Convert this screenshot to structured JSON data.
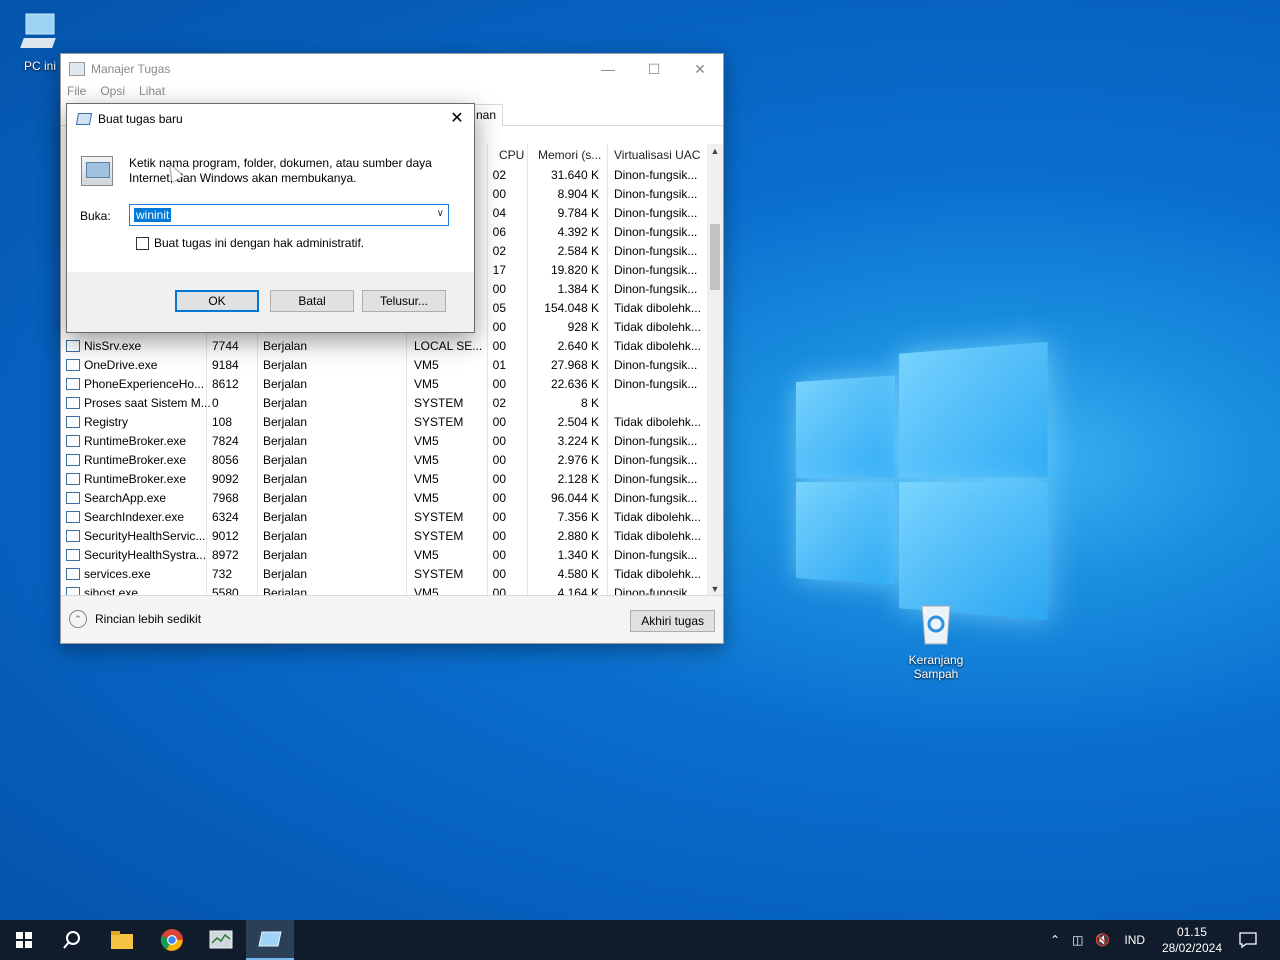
{
  "desktop": {
    "icons": [
      {
        "label": "PC ini"
      },
      {
        "label": "Keranjang Sampah"
      }
    ]
  },
  "taskmgr": {
    "title": "Manajer Tugas",
    "menu": [
      "File",
      "Opsi",
      "Lihat"
    ],
    "tab_partial": "nan",
    "columns": {
      "cpu": "CPU",
      "memory": "Memori (s...",
      "uac": "Virtualisasi UAC"
    },
    "rows": [
      {
        "name": "",
        "pid": "",
        "status": "",
        "user": "",
        "cpu": "02",
        "mem": "31.640 K",
        "uac": "Dinon-fungsik..."
      },
      {
        "name": "",
        "pid": "",
        "status": "",
        "user": "",
        "cpu": "00",
        "mem": "8.904 K",
        "uac": "Dinon-fungsik..."
      },
      {
        "name": "",
        "pid": "",
        "status": "",
        "user": "",
        "cpu": "04",
        "mem": "9.784 K",
        "uac": "Dinon-fungsik..."
      },
      {
        "name": "",
        "pid": "",
        "status": "",
        "user": "",
        "cpu": "06",
        "mem": "4.392 K",
        "uac": "Dinon-fungsik..."
      },
      {
        "name": "",
        "pid": "",
        "status": "",
        "user": "",
        "cpu": "02",
        "mem": "2.584 K",
        "uac": "Dinon-fungsik..."
      },
      {
        "name": "",
        "pid": "",
        "status": "",
        "user": "",
        "cpu": "17",
        "mem": "19.820 K",
        "uac": "Dinon-fungsik..."
      },
      {
        "name": "",
        "pid": "",
        "status": "",
        "user": "",
        "cpu": "00",
        "mem": "1.384 K",
        "uac": "Dinon-fungsik..."
      },
      {
        "name": "",
        "pid": "",
        "status": "",
        "user": "",
        "cpu": "05",
        "mem": "154.048 K",
        "uac": "Tidak dibolehk..."
      },
      {
        "name": "",
        "pid": "",
        "status": "",
        "user": "",
        "cpu": "00",
        "mem": "928 K",
        "uac": "Tidak dibolehk..."
      },
      {
        "name": "NisSrv.exe",
        "pid": "7744",
        "status": "Berjalan",
        "user": "LOCAL SE...",
        "cpu": "00",
        "mem": "2.640 K",
        "uac": "Tidak dibolehk..."
      },
      {
        "name": "OneDrive.exe",
        "pid": "9184",
        "status": "Berjalan",
        "user": "VM5",
        "cpu": "01",
        "mem": "27.968 K",
        "uac": "Dinon-fungsik..."
      },
      {
        "name": "PhoneExperienceHo...",
        "pid": "8612",
        "status": "Berjalan",
        "user": "VM5",
        "cpu": "00",
        "mem": "22.636 K",
        "uac": "Dinon-fungsik..."
      },
      {
        "name": "Proses saat Sistem M...",
        "pid": "0",
        "status": "Berjalan",
        "user": "SYSTEM",
        "cpu": "02",
        "mem": "8 K",
        "uac": ""
      },
      {
        "name": "Registry",
        "pid": "108",
        "status": "Berjalan",
        "user": "SYSTEM",
        "cpu": "00",
        "mem": "2.504 K",
        "uac": "Tidak dibolehk..."
      },
      {
        "name": "RuntimeBroker.exe",
        "pid": "7824",
        "status": "Berjalan",
        "user": "VM5",
        "cpu": "00",
        "mem": "3.224 K",
        "uac": "Dinon-fungsik..."
      },
      {
        "name": "RuntimeBroker.exe",
        "pid": "8056",
        "status": "Berjalan",
        "user": "VM5",
        "cpu": "00",
        "mem": "2.976 K",
        "uac": "Dinon-fungsik..."
      },
      {
        "name": "RuntimeBroker.exe",
        "pid": "9092",
        "status": "Berjalan",
        "user": "VM5",
        "cpu": "00",
        "mem": "2.128 K",
        "uac": "Dinon-fungsik..."
      },
      {
        "name": "SearchApp.exe",
        "pid": "7968",
        "status": "Berjalan",
        "user": "VM5",
        "cpu": "00",
        "mem": "96.044 K",
        "uac": "Dinon-fungsik..."
      },
      {
        "name": "SearchIndexer.exe",
        "pid": "6324",
        "status": "Berjalan",
        "user": "SYSTEM",
        "cpu": "00",
        "mem": "7.356 K",
        "uac": "Tidak dibolehk..."
      },
      {
        "name": "SecurityHealthServic...",
        "pid": "9012",
        "status": "Berjalan",
        "user": "SYSTEM",
        "cpu": "00",
        "mem": "2.880 K",
        "uac": "Tidak dibolehk..."
      },
      {
        "name": "SecurityHealthSystra...",
        "pid": "8972",
        "status": "Berjalan",
        "user": "VM5",
        "cpu": "00",
        "mem": "1.340 K",
        "uac": "Dinon-fungsik..."
      },
      {
        "name": "services.exe",
        "pid": "732",
        "status": "Berjalan",
        "user": "SYSTEM",
        "cpu": "00",
        "mem": "4.580 K",
        "uac": "Tidak dibolehk..."
      },
      {
        "name": "sihost.exe",
        "pid": "5580",
        "status": "Berjalan",
        "user": "VM5",
        "cpu": "00",
        "mem": "4.164 K",
        "uac": "Dinon-fungsik..."
      }
    ],
    "fewer_details": "Rincian lebih sedikit",
    "end_task": "Akhiri tugas"
  },
  "dialog": {
    "title": "Buat tugas baru",
    "message": "Ketik nama program, folder, dokumen, atau sumber daya Internet, dan Windows akan membukanya.",
    "open_label": "Buka:",
    "open_value": "wininit",
    "admin_checkbox": "Buat tugas ini dengan hak administratif.",
    "admin_checked": false,
    "ok": "OK",
    "cancel": "Batal",
    "browse": "Telusur..."
  },
  "taskbar": {
    "lang": "IND",
    "time": "01.15",
    "date": "28/02/2024"
  },
  "colors": {
    "accent": "#0078d7",
    "taskbar": "#101c2b",
    "desktop": "#0a6fcf"
  }
}
